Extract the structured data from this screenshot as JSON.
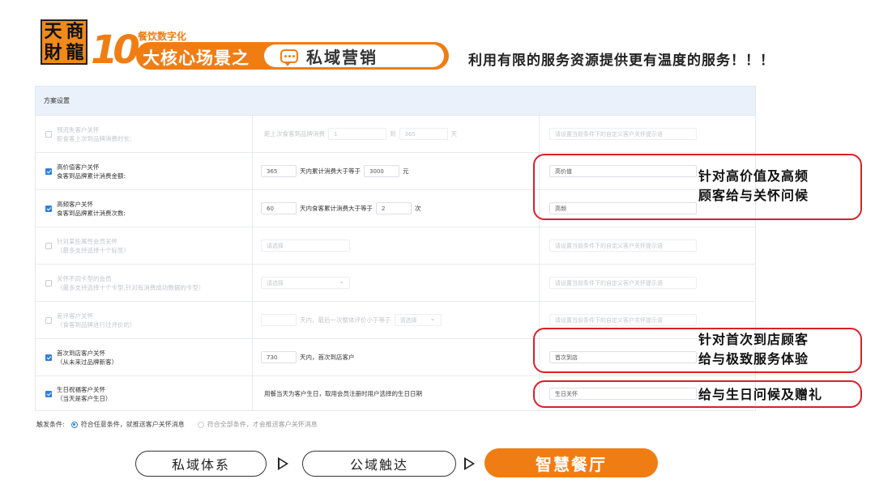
{
  "header": {
    "logo_chars": [
      "天",
      "商",
      "財",
      "龍"
    ],
    "number": "10",
    "sub_title": "餐饮数字化",
    "main_title": "大核心场景之",
    "pill_label": "私域营销",
    "slogan": "利用有限的服务资源提供更有温度的服务！！！"
  },
  "panel": {
    "title": "方案设置",
    "rows": [
      {
        "checked": false,
        "label1": "预流失客户关怀",
        "label2": "距食客上次到品牌消费时长:",
        "prefix": "距上次食客到品牌消费",
        "from": "1",
        "mid": "到",
        "to": "365",
        "unit": "天",
        "note_placeholder": "请设置当前条件下的自定义客户关怀提示语"
      },
      {
        "checked": true,
        "label1": "高价值客户关怀",
        "label2": "食客到品牌累计消费金额:",
        "days": "365",
        "mid": "天内累计消费大于等于",
        "amount": "3000",
        "unit": "元",
        "note_value": "高价值"
      },
      {
        "checked": true,
        "label1": "高频客户关怀",
        "label2": "食客到品牌累计消费次数:",
        "days": "60",
        "mid": "天内食客累计消费大于等于",
        "count": "2",
        "unit": "次",
        "note_value": "高频"
      },
      {
        "checked": false,
        "label1": "针对某些属性会员关怀",
        "label2": "（最多支持选择十个标签）",
        "select_placeholder": "请选择",
        "note_placeholder": "请设置当前条件下的自定义客户关怀提示语"
      },
      {
        "checked": false,
        "label1": "关怀不同卡型的会员",
        "label2": "（最多支持选择十个卡型,针对有消费成功数据的卡型）",
        "select_placeholder": "请选择",
        "note_placeholder": "请设置当前条件下的自定义客户关怀提示语"
      },
      {
        "checked": false,
        "label1": "差评客户关怀",
        "label2": "（食客到品牌进行过评价的）",
        "mid": "天内，最后一次整体评价小于等于",
        "select_placeholder": "请选择",
        "note_placeholder": "请设置当前条件下的自定义客户关怀提示语"
      },
      {
        "checked": true,
        "label1": "首次到店客户关怀",
        "label2": "（从未来过品牌新客）",
        "days": "730",
        "mid": "天内，首次到店客户",
        "note_value": "首次到店"
      },
      {
        "checked": true,
        "label1": "生日祝福客户关怀",
        "label2": "（当天是客户生日）",
        "text": "用餐当天为客户生日，取用会员注册时用户选择的生日日期",
        "note_value": "生日关怀"
      }
    ],
    "trigger": {
      "label": "触发条件:",
      "option_any": "符合任意条件，就推送客户关怀消息",
      "option_all": "符合全部条件，才会推送客户关怀消息"
    }
  },
  "annotations": {
    "note1_line1": "针对高价值及高频",
    "note1_line2": "顾客给与关怀问候",
    "note2_line1": "针对首次到店顾客",
    "note2_line2": "给与极致服务体验",
    "note3": "给与生日问候及赠礼",
    "border_color": "#d9202a"
  },
  "flow": {
    "step1": "私域体系",
    "step2": "公域触达",
    "step3": "智慧餐厅",
    "accent": "#f07d14"
  }
}
